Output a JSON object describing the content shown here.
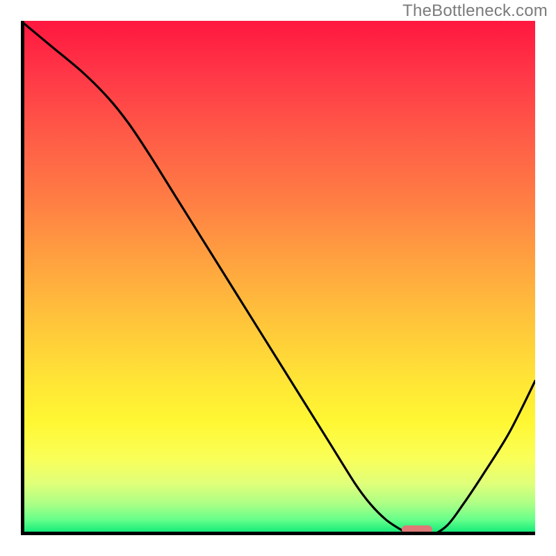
{
  "watermark": "TheBottleneck.com",
  "chart_data": {
    "type": "line",
    "title": "",
    "xlabel": "",
    "ylabel": "",
    "xlim": [
      0,
      100
    ],
    "ylim": [
      0,
      100
    ],
    "grid": false,
    "x": [
      0,
      6,
      12,
      17,
      21,
      25,
      30,
      35,
      40,
      45,
      50,
      55,
      60,
      65,
      68,
      71,
      74,
      76,
      78,
      80,
      83,
      86,
      90,
      95,
      100
    ],
    "values": [
      100,
      95,
      90,
      85,
      80,
      74,
      66,
      58,
      50,
      42,
      34,
      26,
      18,
      10,
      6,
      3,
      1,
      0,
      0,
      0,
      2,
      6,
      12,
      20,
      30
    ],
    "marker": {
      "x": 77,
      "y": 0,
      "color": "#df7977"
    },
    "background_gradient": {
      "top": "#ff173f",
      "mid": "#ffe536",
      "bottom": "#00e676"
    }
  }
}
